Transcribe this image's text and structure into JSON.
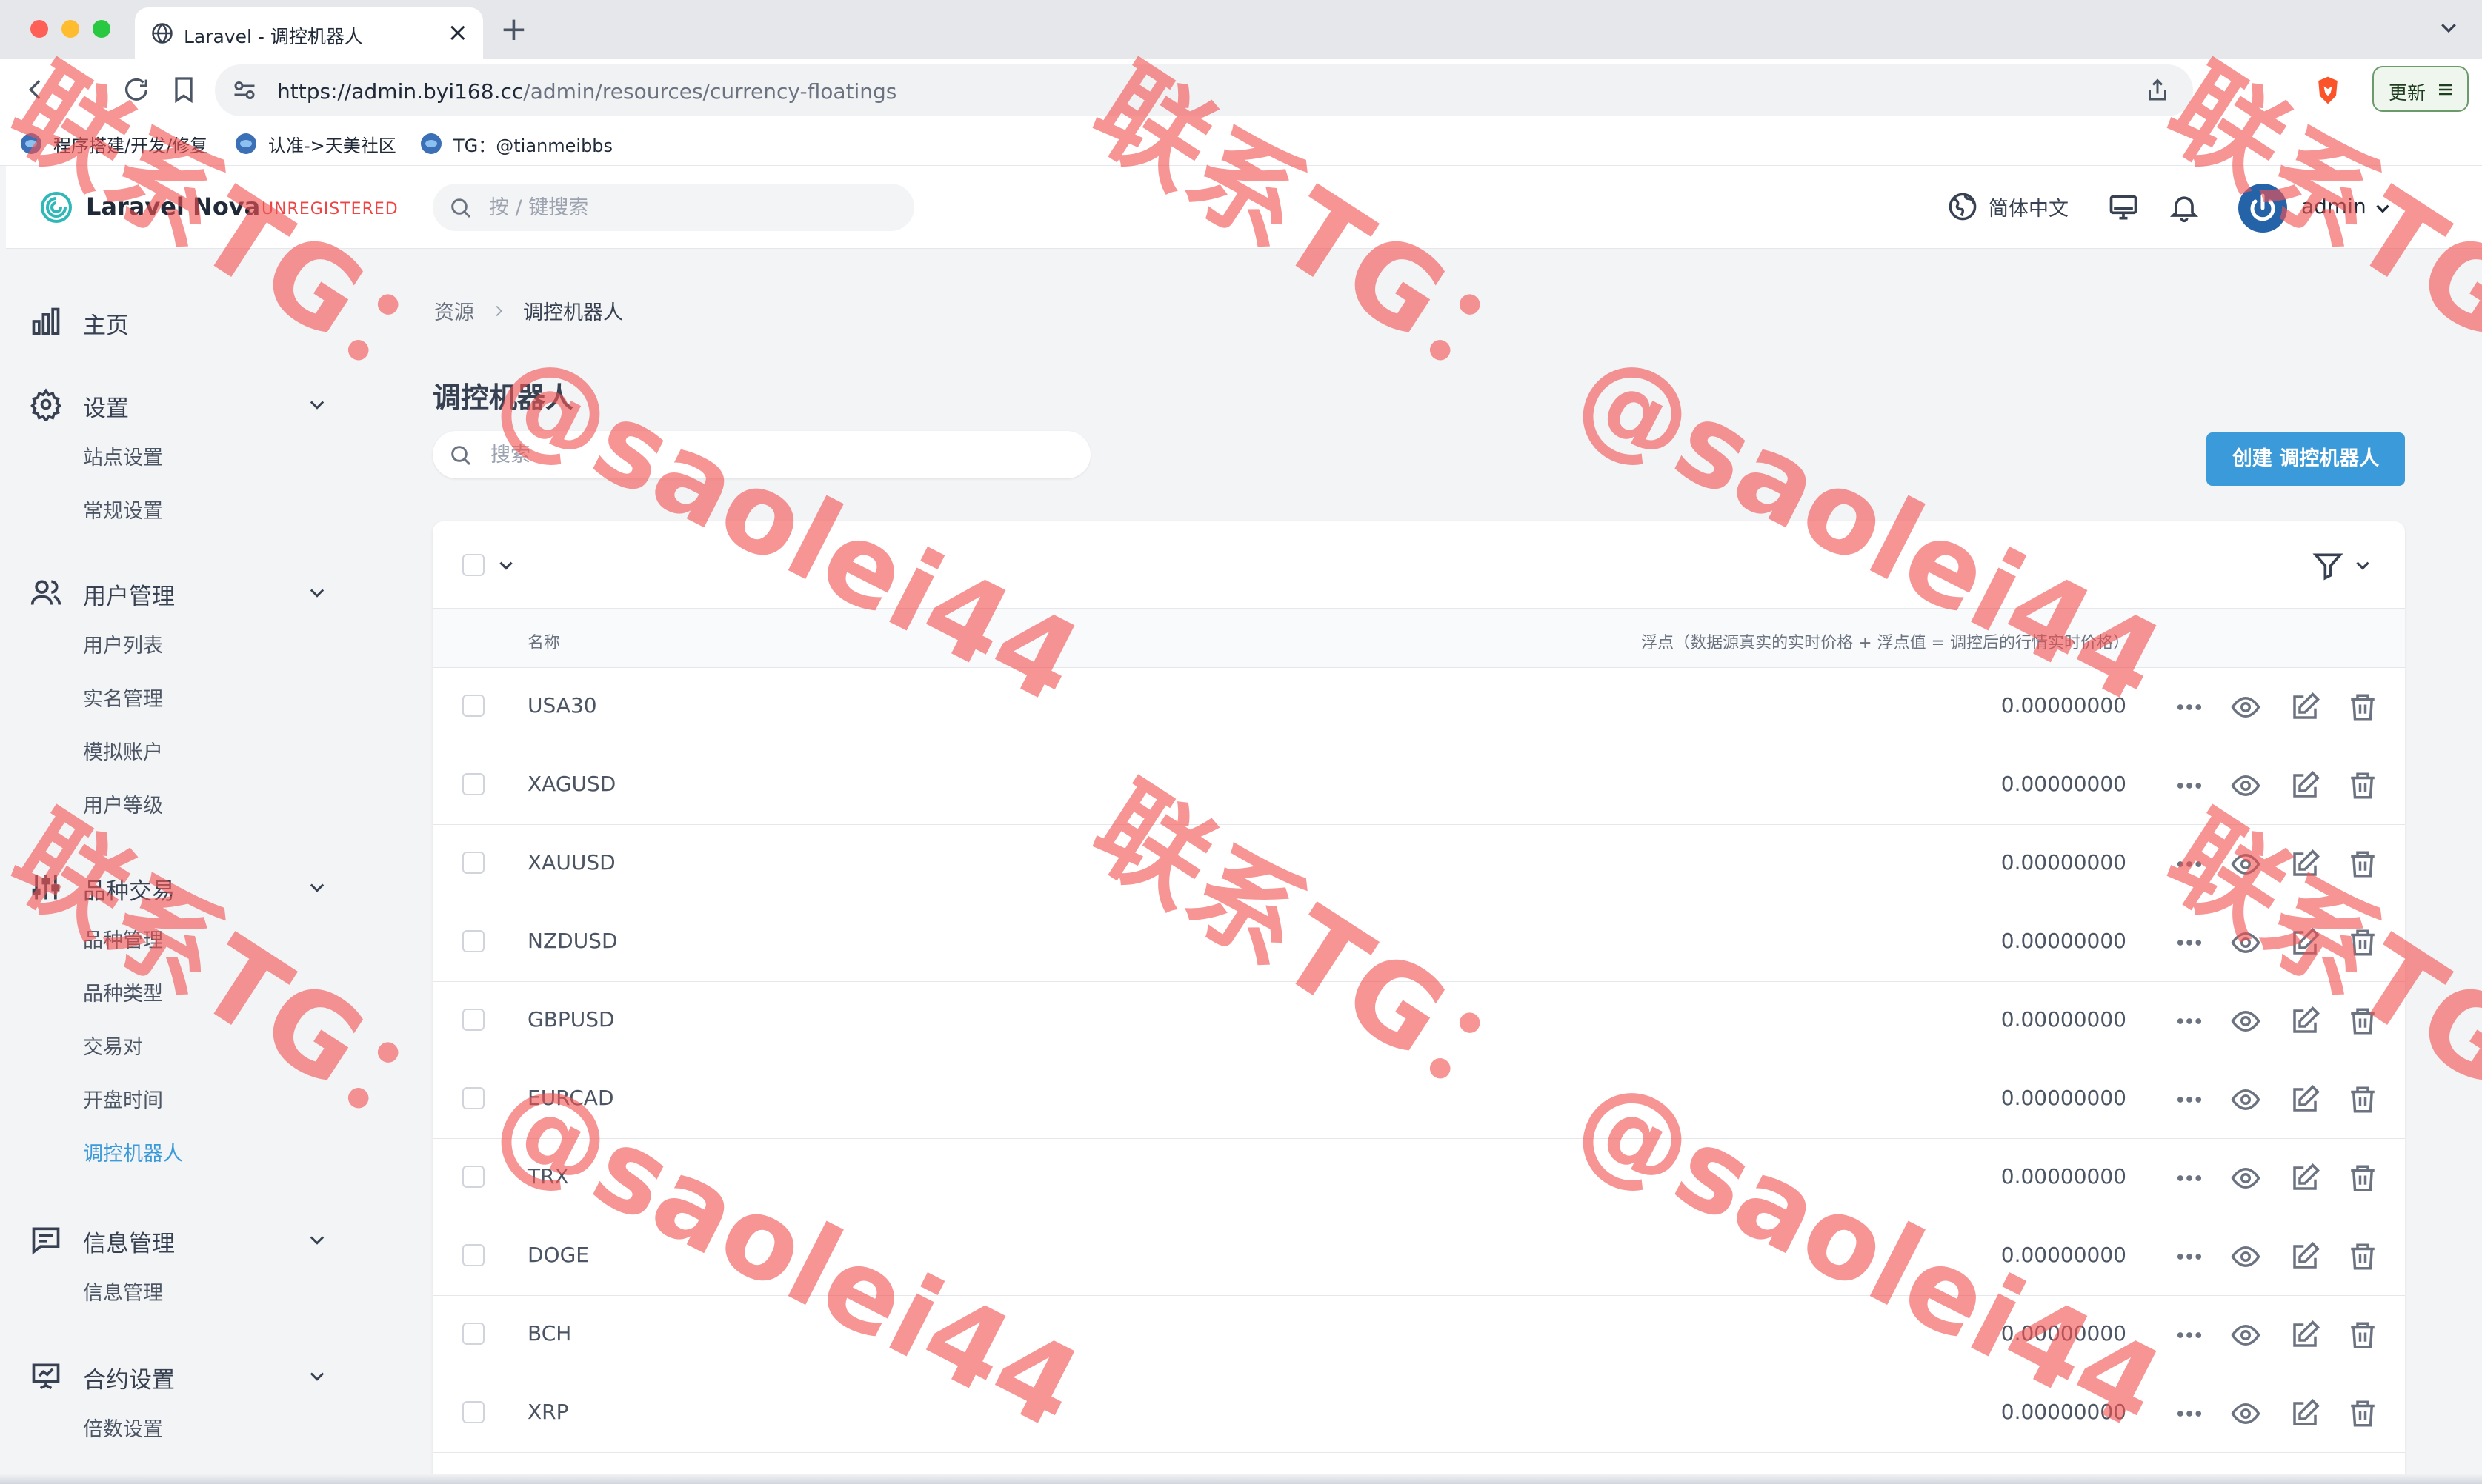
{
  "browser": {
    "tab_title": "Laravel - 调控机器人",
    "url_host": "https://admin.byi168.cc",
    "url_path": "/admin/resources/currency-floatings",
    "update_label": "更新"
  },
  "bookmarks": [
    {
      "label": "程序搭建/开发/修复"
    },
    {
      "label": "认准->天美社区"
    },
    {
      "label": "TG：@tianmeibbs"
    }
  ],
  "header": {
    "logo_text": "Laravel Nova",
    "unregistered": "UNREGISTERED",
    "search_placeholder": "按 / 键搜索",
    "language": "简体中文",
    "user_name": "admin"
  },
  "sidebar": {
    "home": "主页",
    "groups": [
      {
        "label": "设置",
        "items": [
          "站点设置",
          "常规设置"
        ]
      },
      {
        "label": "用户管理",
        "items": [
          "用户列表",
          "实名管理",
          "模拟账户",
          "用户等级"
        ]
      },
      {
        "label": "品种交易",
        "items": [
          "品种管理",
          "品种类型",
          "交易对",
          "开盘时间",
          "调控机器人"
        ]
      },
      {
        "label": "信息管理",
        "items": [
          "信息管理"
        ]
      },
      {
        "label": "合约设置",
        "items": [
          "倍数设置"
        ]
      }
    ]
  },
  "main": {
    "breadcrumb_root": "资源",
    "breadcrumb_current": "调控机器人",
    "page_title": "调控机器人",
    "search_placeholder": "搜索",
    "create_button": "创建 调控机器人",
    "columns": {
      "name": "名称",
      "float": "浮点（数据源真实的实时价格 + 浮点值 = 调控后的行情实时价格）"
    },
    "rows": [
      {
        "name": "USA30",
        "value": "0.00000000"
      },
      {
        "name": "XAGUSD",
        "value": "0.00000000"
      },
      {
        "name": "XAUUSD",
        "value": "0.00000000"
      },
      {
        "name": "NZDUSD",
        "value": "0.00000000"
      },
      {
        "name": "GBPUSD",
        "value": "0.00000000"
      },
      {
        "name": "EURCAD",
        "value": "0.00000000"
      },
      {
        "name": "TRX",
        "value": "0.00000000"
      },
      {
        "name": "DOGE",
        "value": "0.00000000"
      },
      {
        "name": "BCH",
        "value": "0.00000000"
      },
      {
        "name": "XRP",
        "value": "0.00000000"
      }
    ]
  },
  "watermark": {
    "line1": "联系TG：",
    "line2": "@saolei44"
  },
  "colors": {
    "accent": "#3b9ad9",
    "unregistered": "#ef4444",
    "watermark": "#f25252"
  }
}
